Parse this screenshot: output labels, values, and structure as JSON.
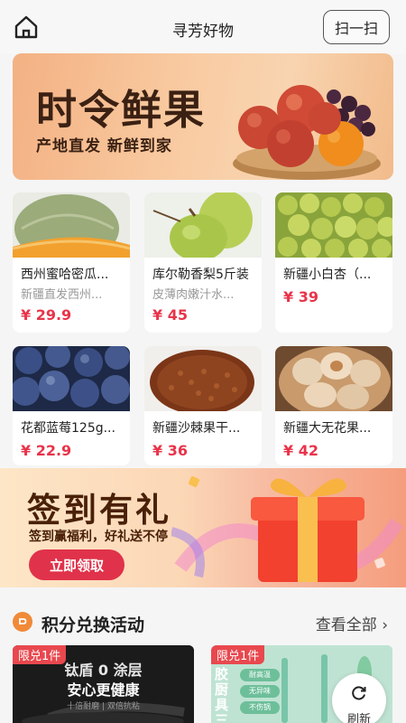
{
  "header": {
    "title": "寻芳好物",
    "scan_label": "扫一扫"
  },
  "banner": {
    "title": "时令鲜果",
    "subtitle": "产地直发 新鲜到家"
  },
  "products": [
    {
      "name": "西州蜜哈密瓜...",
      "desc": "新疆直发西州...",
      "price": "¥ 29.9"
    },
    {
      "name": "库尔勒香梨5斤装",
      "desc": "皮薄肉嫩汁水...",
      "price": "¥ 45"
    },
    {
      "name": "新疆小白杏（...",
      "desc": "",
      "price": "¥ 39"
    },
    {
      "name": "花都蓝莓125g...",
      "desc": "",
      "price": "¥ 22.9"
    },
    {
      "name": "新疆沙棘果干...",
      "desc": "",
      "price": "¥ 36"
    },
    {
      "name": "新疆大无花果...",
      "desc": "",
      "price": "¥ 42"
    }
  ],
  "sign_in": {
    "title": "签到有礼",
    "subtitle": "签到赢福利，好礼送不停",
    "button": "立即领取"
  },
  "points": {
    "title": "积分兑换活动",
    "see_all": "查看全部 ›"
  },
  "promos": [
    {
      "tag": "限兑1件",
      "line1": "钛盾 0 涂层",
      "line2": "安心更健康",
      "line3": "十倍耐磨 | 双倍抗粘"
    },
    {
      "tag": "限兑1件",
      "vertical": "胶厨具三",
      "badges": [
        "耐高温",
        "无异味",
        "不伤锅"
      ]
    }
  ],
  "refresh_label": "刷新",
  "colors": {
    "price": "#e8344a",
    "accent": "#e0324a",
    "points_icon": "#f08a38"
  }
}
